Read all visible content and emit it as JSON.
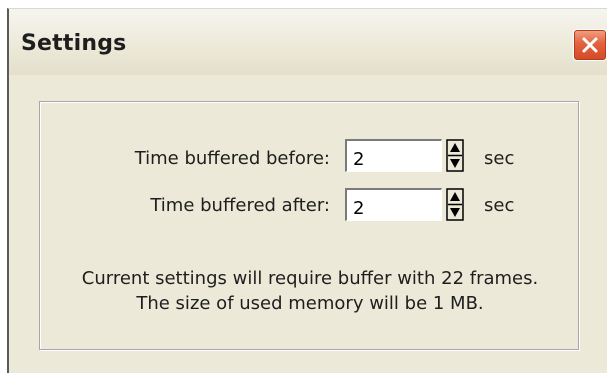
{
  "window": {
    "title": "Settings"
  },
  "fields": {
    "before": {
      "label": "Time buffered before:",
      "value": "2",
      "unit": "sec"
    },
    "after": {
      "label": "Time buffered after:",
      "value": "2",
      "unit": "sec"
    }
  },
  "info": {
    "line1": "Current settings will require buffer with 22 frames.",
    "line2": "The size of used memory will be 1 MB."
  },
  "icons": {
    "close": "close-icon",
    "spin_up": "arrow-up-icon",
    "spin_down": "arrow-down-icon"
  },
  "colors": {
    "window_bg": "#ece9d8",
    "close_button": "#e3623d"
  }
}
